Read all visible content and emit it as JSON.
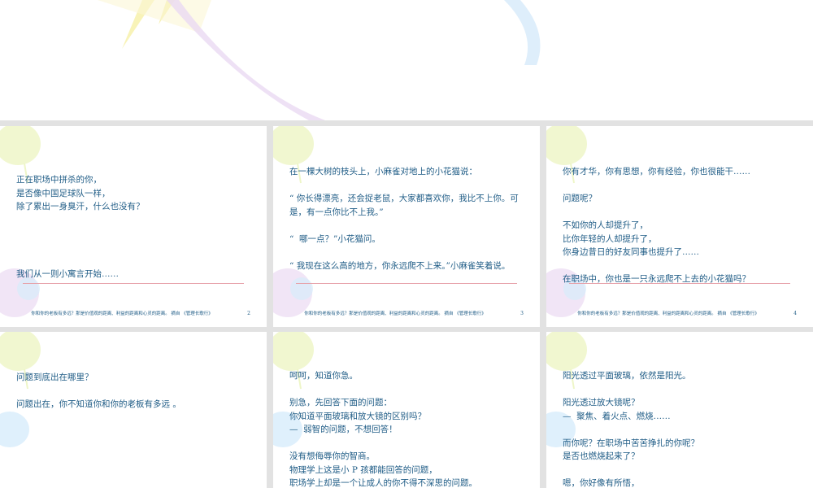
{
  "footer_text": "你和你的老板有多远？那是价值观的距离、利益的距离和心灵的距离。 摘自 《管理长歌行》",
  "slides": [
    {
      "page": "2",
      "text": "正在职场中拼杀的你，\n是否像中国足球队一样，\n除了累出一身臭汗，什么也没有？\n\n\n\n\n我们从一则小寓言开始……"
    },
    {
      "page": "3",
      "text": "在一棵大树的枝头上，小麻雀对地上的小花猫说：\n\n“ 你长得漂亮，还会捉老鼠，大家都喜欢你，我比不上你。可是，有一点你比不上我。”\n\n“  哪一点？”小花猫问。\n\n“ 我现在这么高的地方，你永远爬不上来。”小麻雀笑着说。"
    },
    {
      "page": "4",
      "text": "你有才华，你有思想，你有经验，你也很能干……\n\n问题呢？\n\n不如你的人却提升了，\n比你年轻的人却提升了，\n你身边昔日的好友同事也提升了……\n\n在职场中，你也是一只永远爬不上去的小花猫吗？"
    },
    {
      "page": "",
      "text": "问题到底出在哪里？\n\n问题出在，你不知道你和你的老板有多远 。"
    },
    {
      "page": "",
      "text": "呵呵，知道你急。\n\n别急，先回答下面的问题：\n你知道平面玻璃和放大镜的区别吗？\n—  弱智的问题，不想回答！\n\n没有想侮辱你的智商。\n物理学上这是小 P 孩都能回答的问题，\n职场学上却是一个让成人的你不得不深思的问题。"
    },
    {
      "page": "",
      "text": "阳光透过平面玻璃，依然是阳光。\n\n阳光透过放大镜呢？\n—  聚焦、着火点、燃烧……\n\n而你呢？在职场中苦苦挣扎的你呢？\n是否也燃烧起来了？\n\n嗯，你好像有所悟，\n别急，我们一起继续思考……"
    }
  ]
}
